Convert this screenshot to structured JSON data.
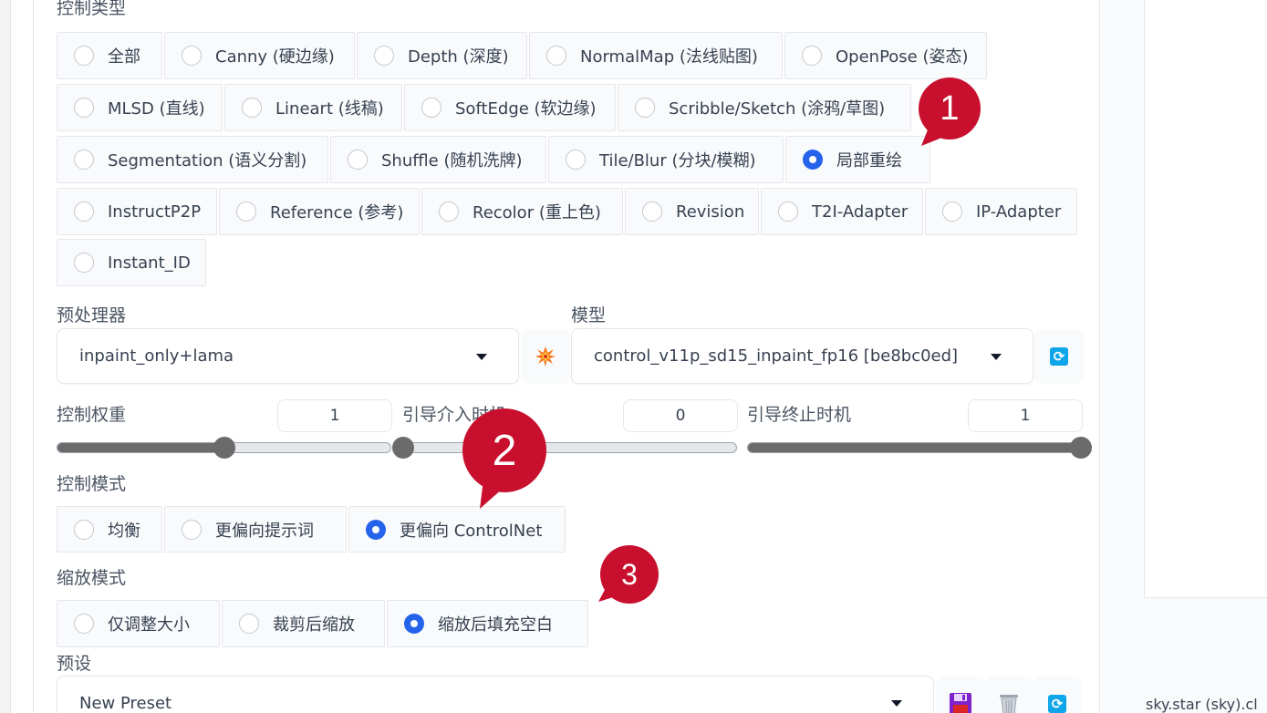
{
  "control_type": {
    "label": "控制类型",
    "options": [
      "全部",
      "Canny (硬边缘)",
      "Depth (深度)",
      "NormalMap (法线贴图)",
      "OpenPose (姿态)",
      "MLSD (直线)",
      "Lineart (线稿)",
      "SoftEdge (软边缘)",
      "Scribble/Sketch (涂鸦/草图)",
      "Segmentation (语义分割)",
      "Shuffle (随机洗牌)",
      "Tile/Blur (分块/模糊)",
      "局部重绘",
      "InstructP2P",
      "Reference (参考)",
      "Recolor (重上色)",
      "Revision",
      "T2I-Adapter",
      "IP-Adapter",
      "Instant_ID"
    ],
    "selected": "局部重绘"
  },
  "preprocessor": {
    "label": "预处理器",
    "value": "inpaint_only+lama"
  },
  "model": {
    "label": "模型",
    "value": "control_v11p_sd15_inpaint_fp16 [be8bc0ed]"
  },
  "icons": {
    "run_preprocessor": "explosion-icon",
    "refresh": "refresh-icon",
    "save": "floppy-disk-icon",
    "delete": "trash-icon"
  },
  "sliders": {
    "weight": {
      "label": "控制权重",
      "value": "1",
      "fraction": 0.5
    },
    "start": {
      "label": "引导介入时机",
      "value": "0",
      "fraction": 0.0
    },
    "end": {
      "label": "引导终止时机",
      "value": "1",
      "fraction": 1.0
    }
  },
  "control_mode": {
    "label": "控制模式",
    "options": [
      "均衡",
      "更偏向提示词",
      "更偏向 ControlNet"
    ],
    "selected": "更偏向 ControlNet"
  },
  "resize_mode": {
    "label": "缩放模式",
    "options": [
      "仅调整大小",
      "裁剪后缩放",
      "缩放后填充空白"
    ],
    "selected": "缩放后填充空白"
  },
  "preset": {
    "label": "预设",
    "value": "New Preset"
  },
  "badges": [
    "1",
    "2",
    "3"
  ],
  "right_footer": "sky.star (sky).cl",
  "colors": {
    "accent": "#2563eb",
    "badge": "#c8102e",
    "slider": "#6b6b6b",
    "refresh": "#0ea5e9"
  }
}
